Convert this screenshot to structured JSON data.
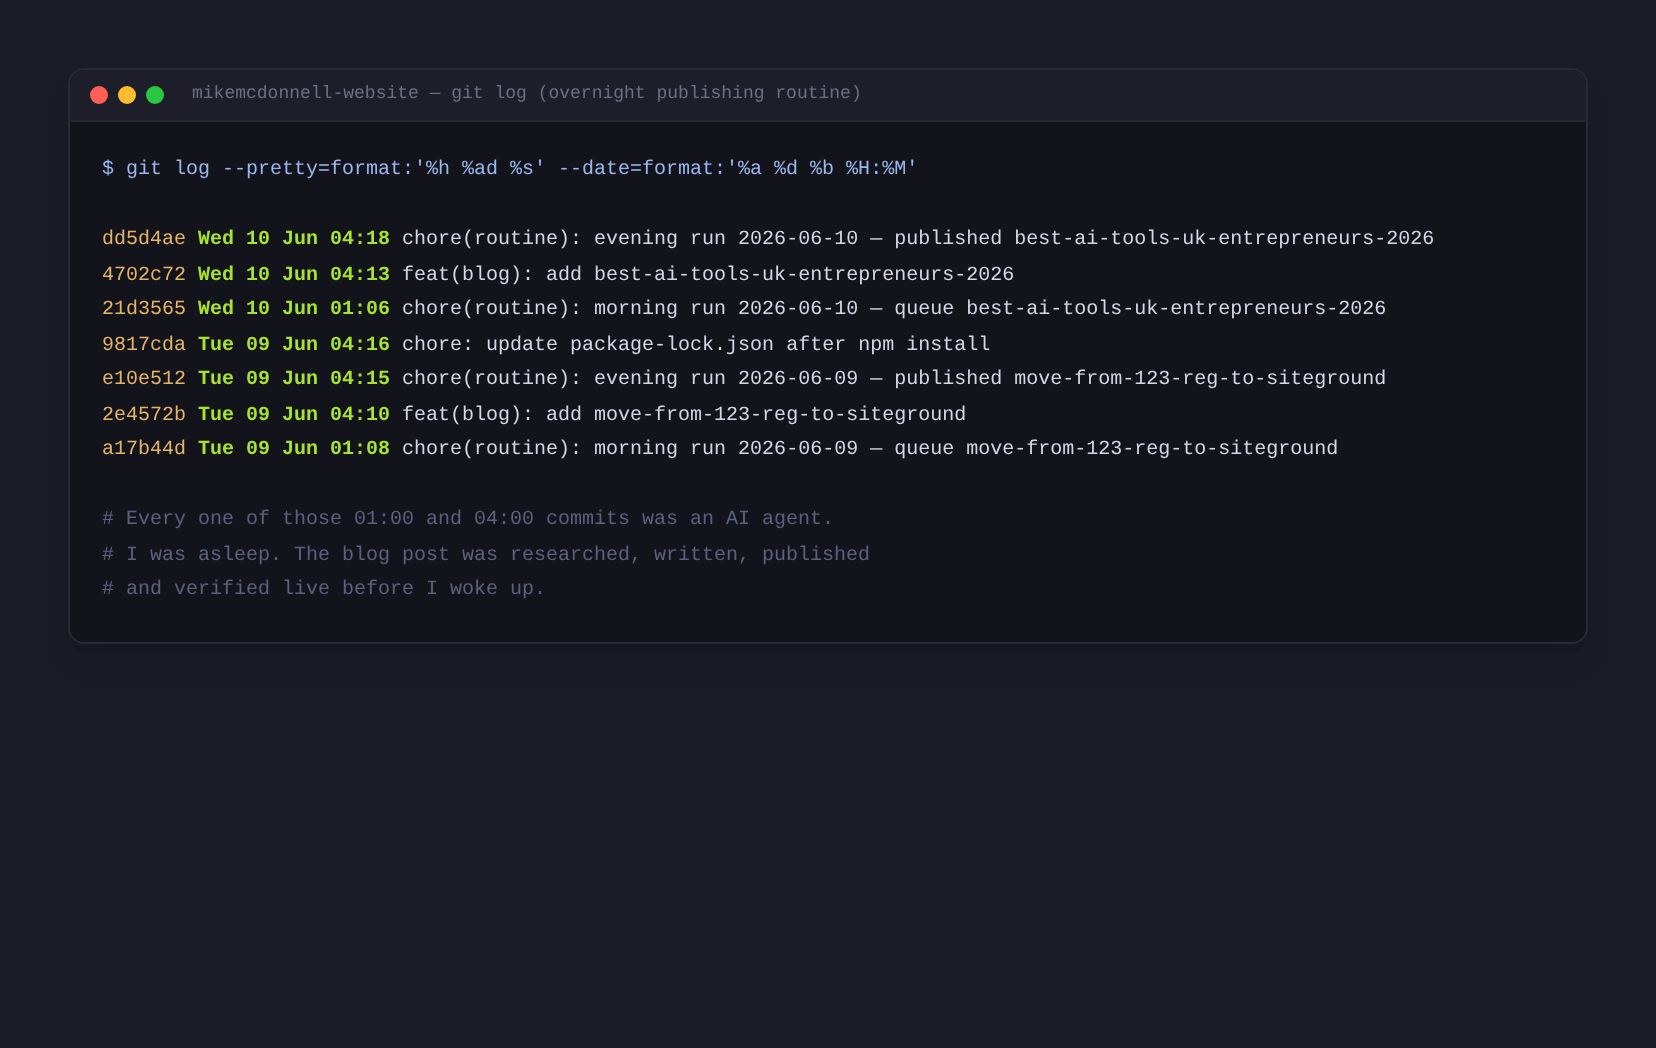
{
  "window": {
    "title": "mikemcdonnell-website — git log (overnight publishing routine)"
  },
  "command": "$ git log --pretty=format:'%h %ad %s' --date=format:'%a %d %b %H:%M'",
  "commits": [
    {
      "hash": "dd5d4ae",
      "date": "Wed 10 Jun 04:18",
      "message": "chore(routine): evening run 2026-06-10 — published best-ai-tools-uk-entrepreneurs-2026"
    },
    {
      "hash": "4702c72",
      "date": "Wed 10 Jun 04:13",
      "message": "feat(blog): add best-ai-tools-uk-entrepreneurs-2026"
    },
    {
      "hash": "21d3565",
      "date": "Wed 10 Jun 01:06",
      "message": "chore(routine): morning run 2026-06-10 — queue best-ai-tools-uk-entrepreneurs-2026"
    },
    {
      "hash": "9817cda",
      "date": "Tue 09 Jun 04:16",
      "message": "chore: update package-lock.json after npm install"
    },
    {
      "hash": "e10e512",
      "date": "Tue 09 Jun 04:15",
      "message": "chore(routine): evening run 2026-06-09 — published move-from-123-reg-to-siteground"
    },
    {
      "hash": "2e4572b",
      "date": "Tue 09 Jun 04:10",
      "message": "feat(blog): add move-from-123-reg-to-siteground"
    },
    {
      "hash": "a17b44d",
      "date": "Tue 09 Jun 01:08",
      "message": "chore(routine): morning run 2026-06-09 — queue move-from-123-reg-to-siteground"
    }
  ],
  "comments": [
    "# Every one of those 01:00 and 04:00 commits was an AI agent.",
    "# I was asleep. The blog post was researched, written, published",
    "# and verified live before I woke up."
  ]
}
